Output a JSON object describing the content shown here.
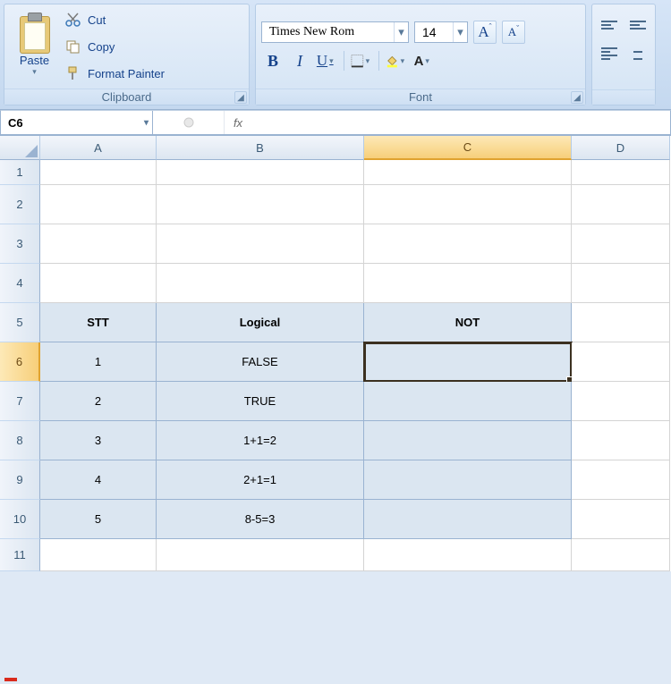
{
  "ribbon": {
    "clipboard": {
      "label": "Clipboard",
      "paste": "Paste",
      "cut": "Cut",
      "copy": "Copy",
      "format_painter": "Format Painter"
    },
    "font": {
      "label": "Font",
      "name": "Times New Rom",
      "size": "14",
      "grow": "A",
      "shrink": "A"
    }
  },
  "fbar": {
    "namebox": "C6",
    "fx": "fx",
    "formula": ""
  },
  "columns": [
    "A",
    "B",
    "C",
    "D"
  ],
  "rows": [
    "1",
    "2",
    "3",
    "4",
    "5",
    "6",
    "7",
    "8",
    "9",
    "10",
    "11"
  ],
  "table": {
    "headers": {
      "a": "STT",
      "b": "Logical",
      "c": "NOT"
    },
    "data": [
      {
        "a": "1",
        "b": "FALSE",
        "c": ""
      },
      {
        "a": "2",
        "b": "TRUE",
        "c": ""
      },
      {
        "a": "3",
        "b": "1+1=2",
        "c": ""
      },
      {
        "a": "4",
        "b": "2+1=1",
        "c": ""
      },
      {
        "a": "5",
        "b": "8-5=3",
        "c": ""
      }
    ]
  },
  "selected_cell": "C6"
}
